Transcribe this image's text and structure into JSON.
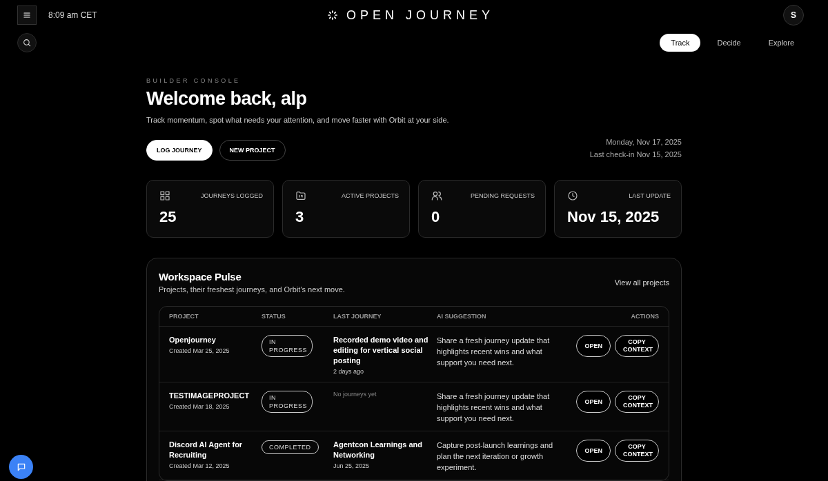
{
  "header": {
    "time": "8:09 am CET",
    "brand": "OPEN JOURNEY",
    "avatar": "S"
  },
  "tabs": [
    {
      "label": "Track",
      "selected": true
    },
    {
      "label": "Decide",
      "selected": false
    },
    {
      "label": "Explore",
      "selected": false
    }
  ],
  "hero": {
    "eyebrow": "BUILDER CONSOLE",
    "title": "Welcome back, alp",
    "subtitle": "Track momentum, spot what needs your attention, and move faster with Orbit at your side.",
    "buttons": [
      {
        "label": "LOG JOURNEY",
        "kind": "primary"
      },
      {
        "label": "NEW PROJECT",
        "kind": "outline"
      }
    ],
    "date": "Monday, Nov 17, 2025",
    "last_checkin": "Last check-in Nov 15, 2025"
  },
  "stats": [
    {
      "kind": "grid",
      "label": "JOURNEYS LOGGED",
      "value": "25"
    },
    {
      "kind": "folder",
      "label": "ACTIVE PROJECTS",
      "value": "3"
    },
    {
      "kind": "users",
      "label": "PENDING REQUESTS",
      "value": "0"
    },
    {
      "kind": "clock",
      "label": "LAST UPDATE",
      "value": "Nov 15, 2025"
    }
  ],
  "pulse": {
    "title": "Workspace Pulse",
    "subtitle": "Projects, their freshest journeys, and Orbit's next move.",
    "link": "View all projects",
    "columns": [
      "PROJECT",
      "STATUS",
      "LAST JOURNEY",
      "AI SUGGESTION",
      "ACTIONS"
    ],
    "rows": [
      {
        "name": "Openjourney",
        "created": "Created Mar 25, 2025",
        "status": "IN PROGRESS",
        "journey": "Recorded demo video and editing for vertical social posting",
        "journey_date": "2 days ago",
        "suggestion": "Share a fresh journey update that highlights recent wins and what support you need next.",
        "actions": [
          "OPEN",
          "COPY CONTEXT"
        ]
      },
      {
        "name": "TESTIMAGEPROJECT",
        "created": "Created Mar 18, 2025",
        "status": "IN PROGRESS",
        "empty_journey": "No journeys yet",
        "suggestion": "Share a fresh journey update that highlights recent wins and what support you need next.",
        "actions": [
          "OPEN",
          "COPY CONTEXT"
        ]
      },
      {
        "name": "Discord AI Agent for Recruiting",
        "created": "Created Mar 12, 2025",
        "status": "COMPLETED",
        "journey": "Agentcon Learnings and Networking",
        "journey_date": "Jun 25, 2025",
        "suggestion": "Capture post-launch learnings and plan the next iteration or growth experiment.",
        "actions": [
          "OPEN",
          "COPY CONTEXT"
        ]
      }
    ]
  }
}
